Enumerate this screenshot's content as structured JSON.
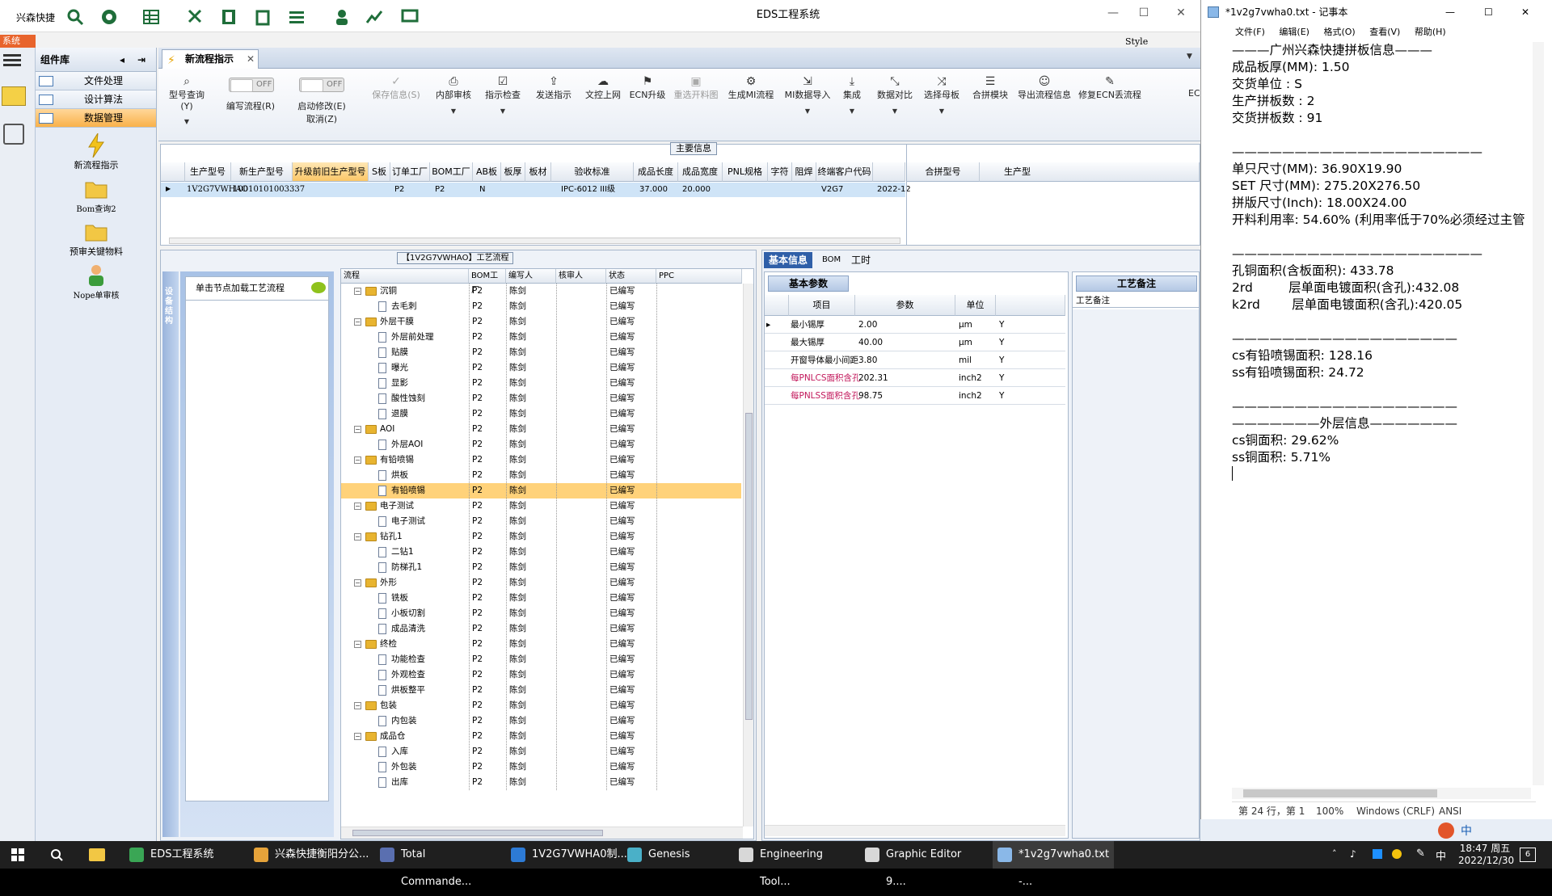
{
  "eds": {
    "app_name": "兴森快捷",
    "window_title": "EDS工程系统",
    "style_label": "Style",
    "sys_tab": "系统",
    "component_lib": "组件库",
    "categories": [
      {
        "label": "文件处理"
      },
      {
        "label": "设计算法"
      },
      {
        "label": "数据管理"
      }
    ],
    "tools": [
      {
        "label": "新流程指示",
        "icon": "lightning-icon"
      },
      {
        "label": "Bom查询2",
        "icon": "folder-icon"
      },
      {
        "label": "预审关键物料",
        "icon": "folder-icon"
      },
      {
        "label": "Nope单审核",
        "icon": "user-icon"
      }
    ],
    "doc_tab": "新流程指示",
    "ribbon": {
      "part_query": "型号查询(Y)",
      "off_label": "OFF",
      "edit_flow": "编写流程(R)",
      "start_modify": "启动修改(E)",
      "cancel": "取消(Z)",
      "save_info": "保存信息(S)",
      "buttons": [
        "内部审核",
        "指示检查",
        "发送指示",
        "文控上网",
        "ECN升级",
        "重选开料图",
        "生成MI流程",
        "MI数据导入",
        "集成",
        "数据对比",
        "选择母板",
        "合拼模块",
        "导出流程信息",
        "修复ECN丢流程",
        "EC"
      ]
    },
    "main_info": {
      "caption": "主要信息",
      "columns": [
        "生产型号",
        "新生产型号",
        "升级前旧生产型号",
        "S板",
        "订单工厂",
        "BOM工厂",
        "AB板",
        "板厚",
        "板材",
        "验收标准",
        "成品长度",
        "成品宽度",
        "PNL规格",
        "字符",
        "阻焊",
        "终端客户代码",
        ""
      ],
      "right_columns": [
        "合拼型号",
        "生产型"
      ],
      "row": {
        "part_no": "1V2G7VWHAO",
        "new_part_no": "10010101003337",
        "order_factory": "P2",
        "bom_factory": "P2",
        "ab": "N",
        "standard": "IPC-6012 III级",
        "length": "37.000",
        "width": "20.000",
        "customer": "V2G7",
        "date": "2022-12"
      }
    },
    "process": {
      "caption": "【1V2G7VWHAO】工艺流程",
      "side_label": "设备结构",
      "node_hint": "单击节点加载工艺流程",
      "columns": [
        "流程",
        "BOM工厂",
        "编写人",
        "核审人",
        "状态",
        "PPC"
      ],
      "rows": [
        {
          "name": "沉铜",
          "level": 0,
          "bom": "P2",
          "writer": "陈剑",
          "status": "已编写"
        },
        {
          "name": "去毛刺",
          "level": 1,
          "bom": "P2",
          "writer": "陈剑",
          "status": "已编写"
        },
        {
          "name": "外层干膜",
          "level": 0,
          "bom": "P2",
          "writer": "陈剑",
          "status": "已编写"
        },
        {
          "name": "外层前处理",
          "level": 1,
          "bom": "P2",
          "writer": "陈剑",
          "status": "已编写"
        },
        {
          "name": "贴膜",
          "level": 1,
          "bom": "P2",
          "writer": "陈剑",
          "status": "已编写"
        },
        {
          "name": "曝光",
          "level": 1,
          "bom": "P2",
          "writer": "陈剑",
          "status": "已编写"
        },
        {
          "name": "显影",
          "level": 1,
          "bom": "P2",
          "writer": "陈剑",
          "status": "已编写"
        },
        {
          "name": "酸性蚀刻",
          "level": 1,
          "bom": "P2",
          "writer": "陈剑",
          "status": "已编写"
        },
        {
          "name": "退膜",
          "level": 1,
          "bom": "P2",
          "writer": "陈剑",
          "status": "已编写"
        },
        {
          "name": "AOI",
          "level": 0,
          "bom": "P2",
          "writer": "陈剑",
          "status": "已编写"
        },
        {
          "name": "外层AOI",
          "level": 1,
          "bom": "P2",
          "writer": "陈剑",
          "status": "已编写"
        },
        {
          "name": "有铅喷锡",
          "level": 0,
          "bom": "P2",
          "writer": "陈剑",
          "status": "已编写"
        },
        {
          "name": "烘板",
          "level": 1,
          "bom": "P2",
          "writer": "陈剑",
          "status": "已编写"
        },
        {
          "name": "有铅喷锡",
          "level": 1,
          "bom": "P2",
          "writer": "陈剑",
          "status": "已编写",
          "selected": true
        },
        {
          "name": "电子测试",
          "level": 0,
          "bom": "P2",
          "writer": "陈剑",
          "status": "已编写"
        },
        {
          "name": "电子测试",
          "level": 1,
          "bom": "P2",
          "writer": "陈剑",
          "status": "已编写"
        },
        {
          "name": "钻孔1",
          "level": 0,
          "bom": "P2",
          "writer": "陈剑",
          "status": "已编写"
        },
        {
          "name": "二钻1",
          "level": 1,
          "bom": "P2",
          "writer": "陈剑",
          "status": "已编写"
        },
        {
          "name": "防梯孔1",
          "level": 1,
          "bom": "P2",
          "writer": "陈剑",
          "status": "已编写"
        },
        {
          "name": "外形",
          "level": 0,
          "bom": "P2",
          "writer": "陈剑",
          "status": "已编写"
        },
        {
          "name": "铣板",
          "level": 1,
          "bom": "P2",
          "writer": "陈剑",
          "status": "已编写"
        },
        {
          "name": "小板切割",
          "level": 1,
          "bom": "P2",
          "writer": "陈剑",
          "status": "已编写"
        },
        {
          "name": "成品清洗",
          "level": 1,
          "bom": "P2",
          "writer": "陈剑",
          "status": "已编写"
        },
        {
          "name": "终检",
          "level": 0,
          "bom": "P2",
          "writer": "陈剑",
          "status": "已编写"
        },
        {
          "name": "功能检查",
          "level": 1,
          "bom": "P2",
          "writer": "陈剑",
          "status": "已编写"
        },
        {
          "name": "外观检查",
          "level": 1,
          "bom": "P2",
          "writer": "陈剑",
          "status": "已编写"
        },
        {
          "name": "烘板整平",
          "level": 1,
          "bom": "P2",
          "writer": "陈剑",
          "status": "已编写"
        },
        {
          "name": "包装",
          "level": 0,
          "bom": "P2",
          "writer": "陈剑",
          "status": "已编写"
        },
        {
          "name": "内包装",
          "level": 1,
          "bom": "P2",
          "writer": "陈剑",
          "status": "已编写"
        },
        {
          "name": "成品仓",
          "level": 0,
          "bom": "P2",
          "writer": "陈剑",
          "status": "已编写"
        },
        {
          "name": "入库",
          "level": 1,
          "bom": "P2",
          "writer": "陈剑",
          "status": "已编写"
        },
        {
          "name": "外包装",
          "level": 1,
          "bom": "P2",
          "writer": "陈剑",
          "status": "已编写"
        },
        {
          "name": "出库",
          "level": 1,
          "bom": "P2",
          "writer": "陈剑",
          "status": "已编写"
        }
      ]
    },
    "info": {
      "tabs": [
        "基本信息",
        "BOM",
        "工时"
      ],
      "basic_params": "基本参数",
      "columns": [
        "项目",
        "参数",
        "单位"
      ],
      "rows": [
        {
          "item": "最小锡厚",
          "value": "2.00",
          "unit": "μm",
          "flag": "Y"
        },
        {
          "item": "最大锡厚",
          "value": "40.00",
          "unit": "μm",
          "flag": "Y"
        },
        {
          "item": "开窗导体最小间距",
          "value": "3.80",
          "unit": "mil",
          "flag": "Y"
        },
        {
          "item": "每PNLCS面积含孔",
          "value": "202.31",
          "unit": "inch2",
          "flag": "Y"
        },
        {
          "item": "每PNLSS面积含孔",
          "value": "98.75",
          "unit": "inch2",
          "flag": "Y"
        }
      ],
      "craft_tab": "工艺备注",
      "craft_header": "工艺备注"
    }
  },
  "notepad": {
    "title": "*1v2g7vwha0.txt - 记事本",
    "menu": [
      "文件(F)",
      "编辑(E)",
      "格式(O)",
      "查看(V)",
      "帮助(H)"
    ],
    "lines": [
      "———广州兴森快捷拼板信息———",
      "成品板厚(MM): 1.50",
      "交货单位 : S",
      "生产拼板数 : 2",
      "交货拼板数 : 91",
      "————————————————————",
      "单只尺寸(MM): 36.90X19.90",
      "SET 尺寸(MM): 275.20X276.50",
      "拼版尺寸(Inch): 18.00X24.00",
      "开料利用率: 54.60% (利用率低于70%必须经过主管",
      "————————————————————",
      "孔铜面积(含板面积): 433.78",
      "2rd         层单面电镀面积(含孔):432.08",
      "k2rd        层单面电镀面积(含孔):420.05",
      "——————————————————",
      "cs有铅喷锡面积: 128.16",
      "ss有铅喷锡面积: 24.72",
      "——————————————————",
      "———————外层信息———————",
      "cs铜面积: 29.62%",
      "ss铜面积: 5.71%"
    ],
    "status": {
      "position": "第 24 行，第 1",
      "zoom": "100%",
      "eol": "Windows (CRLF)",
      "encoding": "ANSI"
    }
  },
  "taskbar": {
    "items": [
      {
        "label": "EDS工程系统",
        "icon": "f-app-icon",
        "color": "#3aa655"
      },
      {
        "label": "兴森快捷衡阳分公...",
        "icon": "browser-icon",
        "color": "#e6a33a"
      },
      {
        "label": "Total Commande...",
        "icon": "disk-icon",
        "color": "#5a6fb0"
      },
      {
        "label": "1V2G7VWHA0制...",
        "icon": "doc-icon",
        "color": "#2d7bd6"
      },
      {
        "label": "Genesis",
        "icon": "genesis-icon",
        "color": "#4ab0c8"
      },
      {
        "label": "Engineering Tool...",
        "icon": "tool-icon",
        "color": "#d8d8d8"
      },
      {
        "label": "Graphic Editor 9....",
        "icon": "graphic-icon",
        "color": "#d8d8d8"
      },
      {
        "label": "*1v2g7vwha0.txt -...",
        "icon": "notepad-icon",
        "color": "#8ab8e8"
      }
    ],
    "time": "18:47 周五",
    "date": "2022/12/30",
    "ime": "中",
    "notif": "6"
  }
}
